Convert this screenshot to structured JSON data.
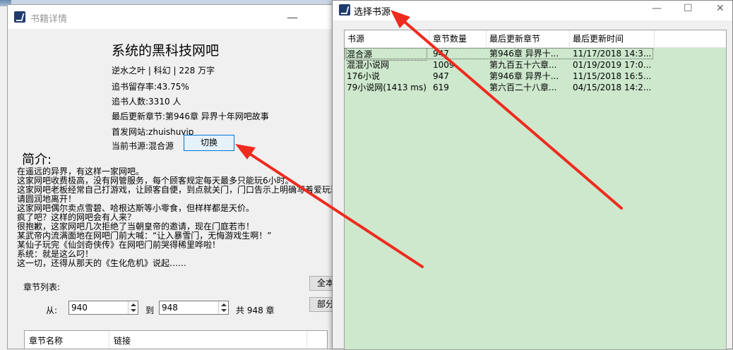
{
  "left_window": {
    "title": "书籍详情",
    "minimize": "—",
    "book_title": "系统的黑科技网吧",
    "meta": "逆水之叶 | 科幻 | 228 万字",
    "retention": "追书留存率:43.75%",
    "followers": "追书人数:3310 人",
    "latest_chapter": "最后更新章节:第946章 异界十年网吧故事",
    "first_site": "首发网站:zhuishuvip",
    "current_source": "当前书源:混合源",
    "switch_button": "切换",
    "intro_label": "简介:",
    "intro_text": "在遥远的异界，有这样一家网吧。\n这家网吧收费极高，没有网管服务，每个顾客规定每天最多只能玩6小时。\n这家网吧老板经常自己打游戏，让顾客自便，到点就关门，门口告示上明确写着爱玩玩\n请圆润地离开！\n这家网吧偶尔卖点雪碧、哈根达斯等小零食，但样样都是天价。\n疯了吧？这样的网吧会有人来？\n很抱歉，这家网吧几次拒绝了当朝皇帝的邀请，现在门庭若市！\n某武帝内流满面地在网吧门前大喊：“让入暴雪门，无悔游戏生啊！”\n某仙子玩完《仙剑奇侠传》在网吧门前哭得稀里哗啦！\n系统：就是这么叼！\n这一切，还得从那天的《生化危机》说起……",
    "chapter_list_label": "章节列表:",
    "from_label": "从:",
    "from_value": "940",
    "to_label": "到",
    "to_value": "948",
    "total_label": "共 948 章",
    "btn_all": "全本",
    "btn_part": "部分",
    "grid_headers": [
      "章节名称",
      "链接"
    ]
  },
  "right_window": {
    "title": "选择书源",
    "controls": [
      "—",
      "☐",
      "✕"
    ],
    "headers": [
      "书源",
      "章节数量",
      "最后更新章节",
      "最后更新时间"
    ],
    "rows": [
      [
        "混合源",
        "947",
        "第946章 异界十...",
        "11/17/2018 14:3..."
      ],
      [
        "混混小说网",
        "1009",
        "第九百五十六章...",
        "01/19/2019 17:0..."
      ],
      [
        "176小说",
        "947",
        "第946章 异界十...",
        "11/15/2018 16:5..."
      ],
      [
        "79小说网(1413 ms)",
        "619",
        "第六百二十八章...",
        "04/15/2018 14:2..."
      ]
    ]
  },
  "colors": {
    "list_bg": "#cde8cd",
    "arrow": "#ee2b1e",
    "button_focus": "#0078d7"
  }
}
